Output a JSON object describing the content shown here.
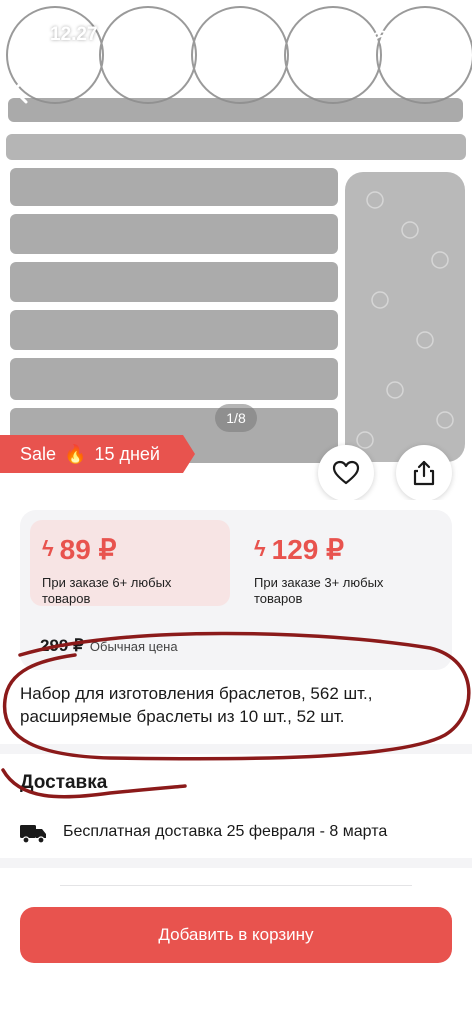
{
  "status_bar": {
    "time": "12.27"
  },
  "gallery": {
    "counter": "1/8"
  },
  "sale_badge": {
    "label": "Sale",
    "icon": "🔥",
    "duration": "15 дней"
  },
  "prices": {
    "tiers": [
      {
        "price": "89 ₽",
        "condition": "При заказе 6+ любых товаров"
      },
      {
        "price": "129 ₽",
        "condition": "При заказе 3+ любых товаров"
      }
    ],
    "regular_price": "299 ₽",
    "regular_label": "Обычная цена"
  },
  "product": {
    "title": "Набор для изготовления браслетов, 562 шт., расширяемые браслеты из 10 шт., 52 шт."
  },
  "delivery": {
    "heading": "Доставка",
    "text": "Бесплатная доставка 25 февраля - 8 марта"
  },
  "cart_button": {
    "label": "Добавить в корзину"
  },
  "colors": {
    "accent": "#e8534e",
    "tier_highlight": "#f7e4e4",
    "card_bg": "#f4f4f6",
    "annotation_ink": "#8b1a1a"
  }
}
